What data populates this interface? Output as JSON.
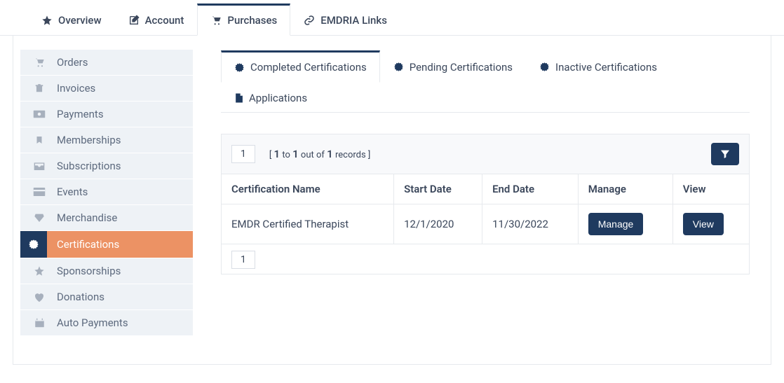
{
  "topTabs": {
    "overview": "Overview",
    "account": "Account",
    "purchases": "Purchases",
    "emdria": "EMDRIA Links"
  },
  "sidebar": {
    "items": [
      {
        "label": "Orders"
      },
      {
        "label": "Invoices"
      },
      {
        "label": "Payments"
      },
      {
        "label": "Memberships"
      },
      {
        "label": "Subscriptions"
      },
      {
        "label": "Events"
      },
      {
        "label": "Merchandise"
      },
      {
        "label": "Certifications"
      },
      {
        "label": "Sponsorships"
      },
      {
        "label": "Donations"
      },
      {
        "label": "Auto Payments"
      }
    ]
  },
  "subTabs": {
    "completed": "Completed Certifications",
    "pending": "Pending Certifications",
    "inactive": "Inactive Certifications",
    "applications": "Applications"
  },
  "pager": {
    "page": "1",
    "from": "1",
    "to": "1",
    "total": "1",
    "textPrefix": "[ ",
    "textMid1": " to ",
    "textMid2": " out of ",
    "textSuffix": " records ]",
    "bottomPage": "1"
  },
  "table": {
    "headers": {
      "name": "Certification Name",
      "start": "Start Date",
      "end": "End Date",
      "manage": "Manage",
      "view": "View"
    },
    "rows": [
      {
        "name": "EMDR Certified Therapist",
        "start": "12/1/2020",
        "end": "11/30/2022"
      }
    ],
    "manageBtn": "Manage",
    "viewBtn": "View"
  }
}
